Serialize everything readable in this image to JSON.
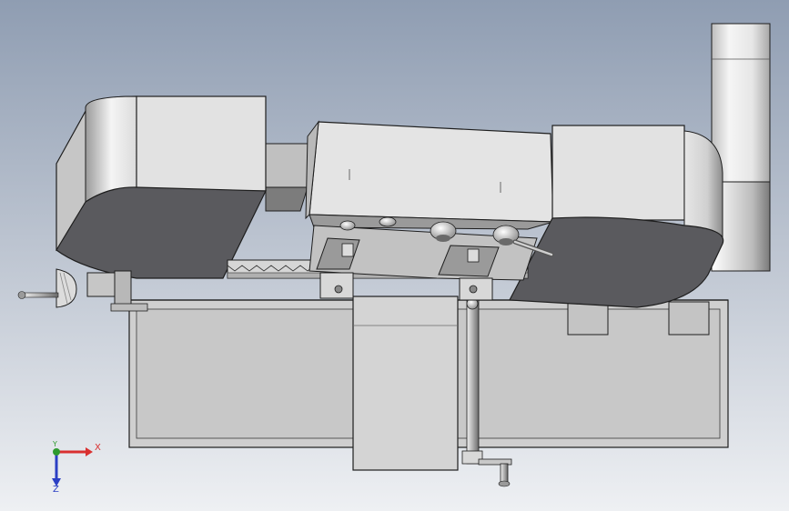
{
  "triad": {
    "x_label": "X",
    "y_label": "Y",
    "z_label": "Z",
    "x_color": "#d93030",
    "y_color": "#2e9a2e",
    "z_color": "#2b3fc4"
  },
  "colors": {
    "background_top": "#8f9db2",
    "background_bottom": "#e9ecf0",
    "part_light": "#e8e8e8",
    "part_mid": "#c9c9c9",
    "part_dark": "#58585c",
    "edge": "#1e1e1e"
  }
}
